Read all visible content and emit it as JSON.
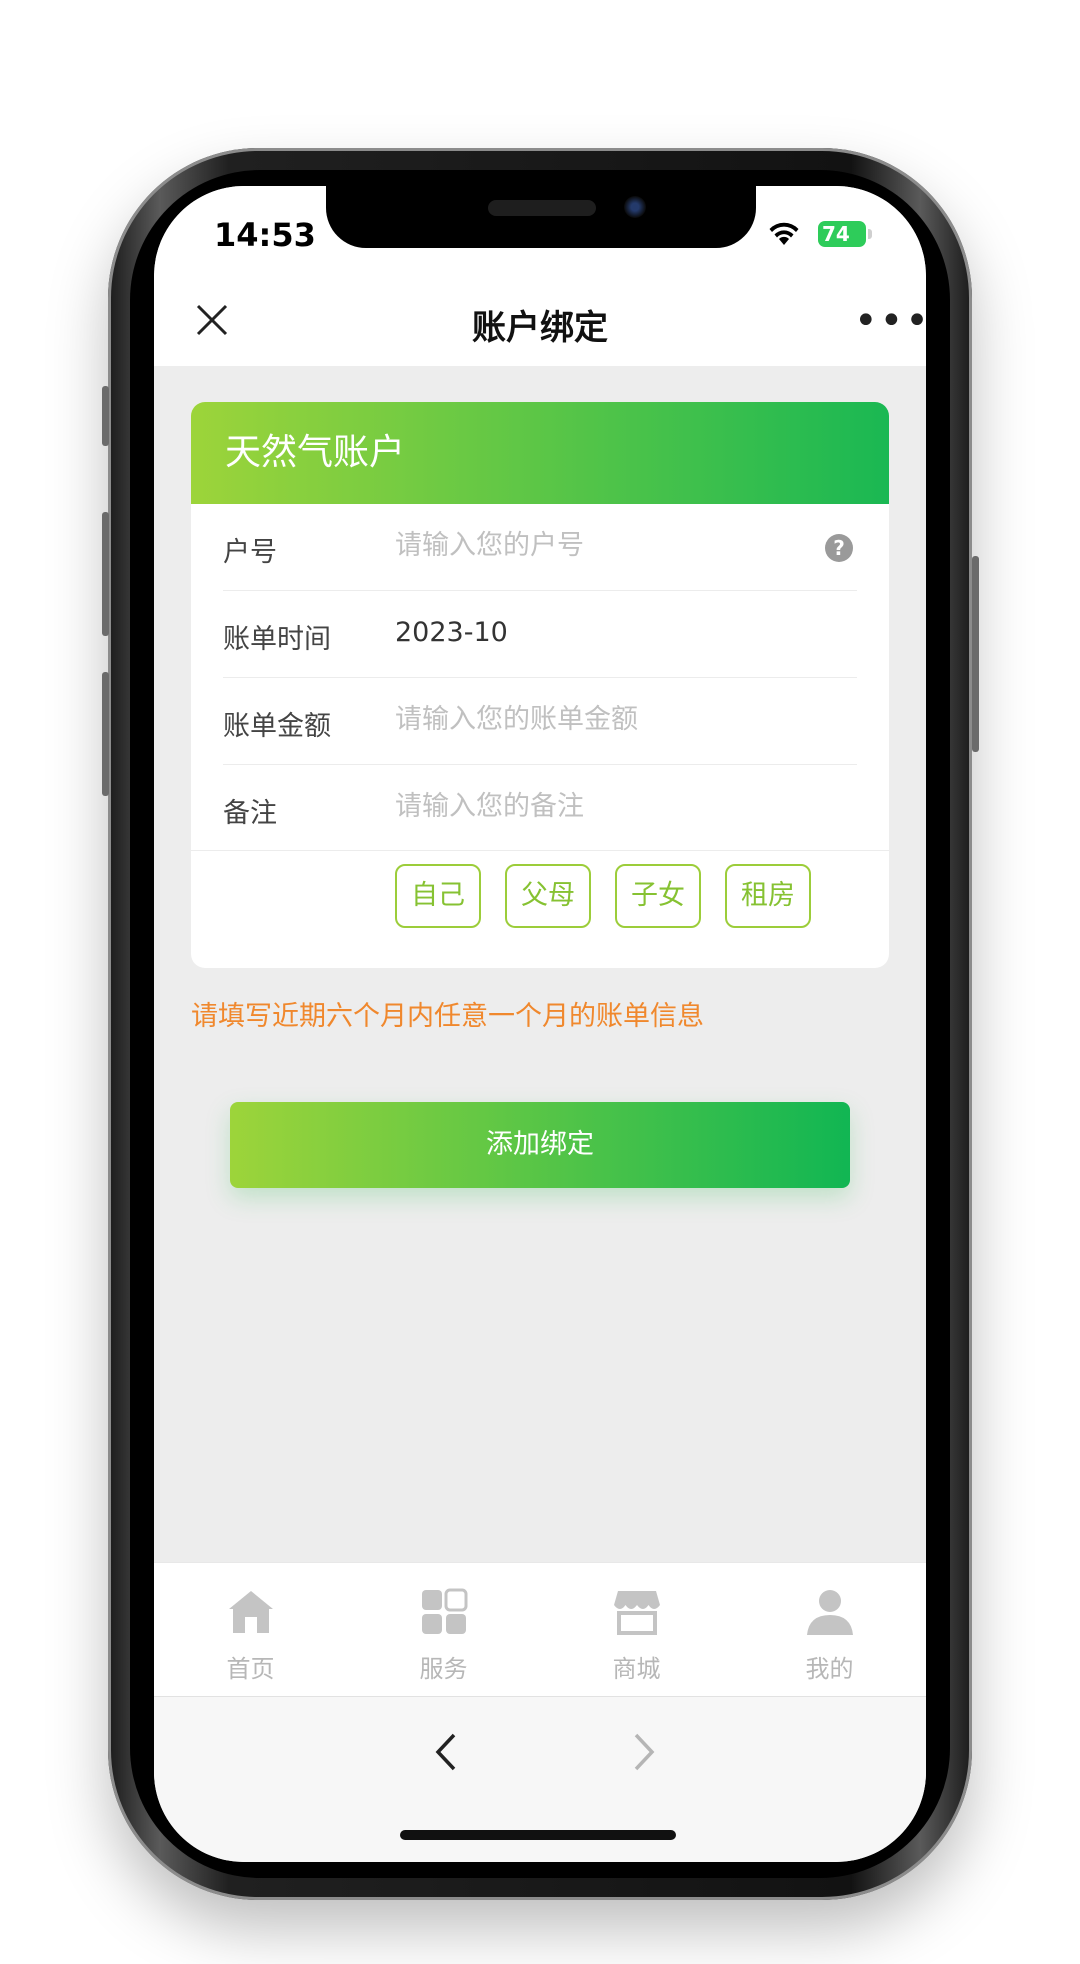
{
  "status": {
    "time": "14:53",
    "battery": "74"
  },
  "navbar": {
    "title": "账户绑定",
    "more": "•••"
  },
  "card": {
    "title": "天然气账户",
    "fields": [
      {
        "label": "户号",
        "value": "",
        "placeholder": "请输入您的户号"
      },
      {
        "label": "账单时间",
        "value": "2023-10",
        "placeholder": ""
      },
      {
        "label": "账单金额",
        "value": "",
        "placeholder": "请输入您的账单金额"
      },
      {
        "label": "备注",
        "value": "",
        "placeholder": "请输入您的备注"
      }
    ],
    "help_glyph": "?",
    "chips": [
      "自己",
      "父母",
      "子女",
      "租房"
    ]
  },
  "notice": "请填写近期六个月内任意一个月的账单信息",
  "submit_label": "添加绑定",
  "tabbar": [
    {
      "label": "首页",
      "icon": "home-icon"
    },
    {
      "label": "服务",
      "icon": "grid-icon"
    },
    {
      "label": "商城",
      "icon": "store-icon"
    },
    {
      "label": "我的",
      "icon": "user-icon"
    }
  ],
  "colors": {
    "accent_start": "#9dd43a",
    "accent_end": "#11b653",
    "notice": "#f0882d",
    "chip": "#86c232"
  }
}
